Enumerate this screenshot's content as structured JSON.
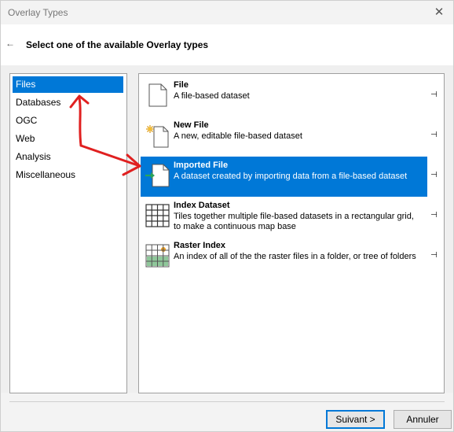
{
  "window": {
    "title": "Overlay Types",
    "close_glyph": "✕",
    "back_glyph": "←",
    "header": "Select one of the available Overlay types"
  },
  "categories": [
    {
      "label": "Files",
      "selected": true
    },
    {
      "label": "Databases",
      "selected": false
    },
    {
      "label": "OGC",
      "selected": false
    },
    {
      "label": "Web",
      "selected": false
    },
    {
      "label": "Analysis",
      "selected": false
    },
    {
      "label": "Miscellaneous",
      "selected": false
    }
  ],
  "overlay_types": [
    {
      "name": "File",
      "description": "A file-based dataset",
      "icon": "file-icon",
      "selected": false
    },
    {
      "name": "New File",
      "description": "A new, editable file-based dataset",
      "icon": "new-file-icon",
      "selected": false
    },
    {
      "name": "Imported File",
      "description": "A dataset created by importing data from a file-based dataset",
      "icon": "imported-file-icon",
      "selected": true
    },
    {
      "name": "Index Dataset",
      "description": "Tiles together multiple file-based datasets in a rectangular grid, to make a continuous map base",
      "icon": "grid-icon",
      "selected": false
    },
    {
      "name": "Raster Index",
      "description": "An index of all of the the raster files in a folder, or tree of folders",
      "icon": "raster-index-icon",
      "selected": false
    }
  ],
  "buttons": {
    "next": "Suivant >",
    "cancel": "Annuler"
  },
  "colors": {
    "selection": "#0078d7",
    "annotation_arrow": "#e02020"
  }
}
